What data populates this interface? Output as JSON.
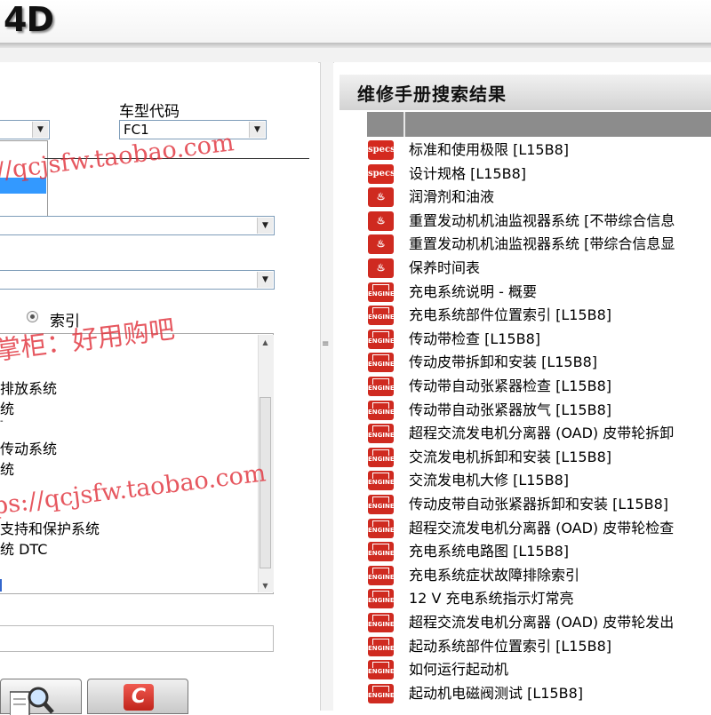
{
  "header": {
    "logo": "4D"
  },
  "left_panel": {
    "model_code_label": "车型代码",
    "model_code_value": "FC1",
    "radio_index_label": "索引",
    "tree_items": [
      "排放系统",
      "统",
      "-",
      "传动系统",
      "统",
      "支持和保护系统",
      "统 DTC"
    ]
  },
  "results": {
    "title": "维修手册搜索结果",
    "items": [
      {
        "icon": "specs",
        "label": "标准和使用极限 [L15B8]"
      },
      {
        "icon": "specs",
        "label": "设计规格 [L15B8]"
      },
      {
        "icon": "oil",
        "label": "润滑剂和油液"
      },
      {
        "icon": "oil",
        "label": "重置发动机机油监视器系统 [不带综合信息"
      },
      {
        "icon": "oil",
        "label": "重置发动机机油监视器系统 [带综合信息显"
      },
      {
        "icon": "oil",
        "label": "保养时间表"
      },
      {
        "icon": "engine",
        "label": "充电系统说明 - 概要"
      },
      {
        "icon": "engine",
        "label": "充电系统部件位置索引 [L15B8]"
      },
      {
        "icon": "engine",
        "label": "传动带检查 [L15B8]"
      },
      {
        "icon": "engine",
        "label": "传动皮带拆卸和安装 [L15B8]"
      },
      {
        "icon": "engine",
        "label": "传动带自动张紧器检查 [L15B8]"
      },
      {
        "icon": "engine",
        "label": "传动带自动张紧器放气 [L15B8]"
      },
      {
        "icon": "engine",
        "label": "超程交流发电机分离器 (OAD) 皮带轮拆卸"
      },
      {
        "icon": "engine",
        "label": "交流发电机拆卸和安装 [L15B8]"
      },
      {
        "icon": "engine",
        "label": "交流发电机大修 [L15B8]"
      },
      {
        "icon": "engine",
        "label": "传动皮带自动张紧器拆卸和安装 [L15B8]"
      },
      {
        "icon": "engine",
        "label": "超程交流发电机分离器 (OAD) 皮带轮检查"
      },
      {
        "icon": "engine",
        "label": "充电系统电路图 [L15B8]"
      },
      {
        "icon": "engine",
        "label": "充电系统症状故障排除索引"
      },
      {
        "icon": "engine",
        "label": "12 V 充电系统指示灯常亮"
      },
      {
        "icon": "engine",
        "label": "超程交流发电机分离器 (OAD) 皮带轮发出"
      },
      {
        "icon": "engine",
        "label": "起动系统部件位置索引 [L15B8]"
      },
      {
        "icon": "engine",
        "label": "如何运行起动机"
      },
      {
        "icon": "engine",
        "label": "起动机电磁阀测试 [L15B8]"
      }
    ]
  },
  "watermarks": {
    "url_1": "//qcjsfw.taobao.com",
    "shopkeeper": "掌柜：好用购吧",
    "url_2": "ps://qcjsfw.taobao.com"
  },
  "buttons": {
    "clear_glyph": "C"
  }
}
